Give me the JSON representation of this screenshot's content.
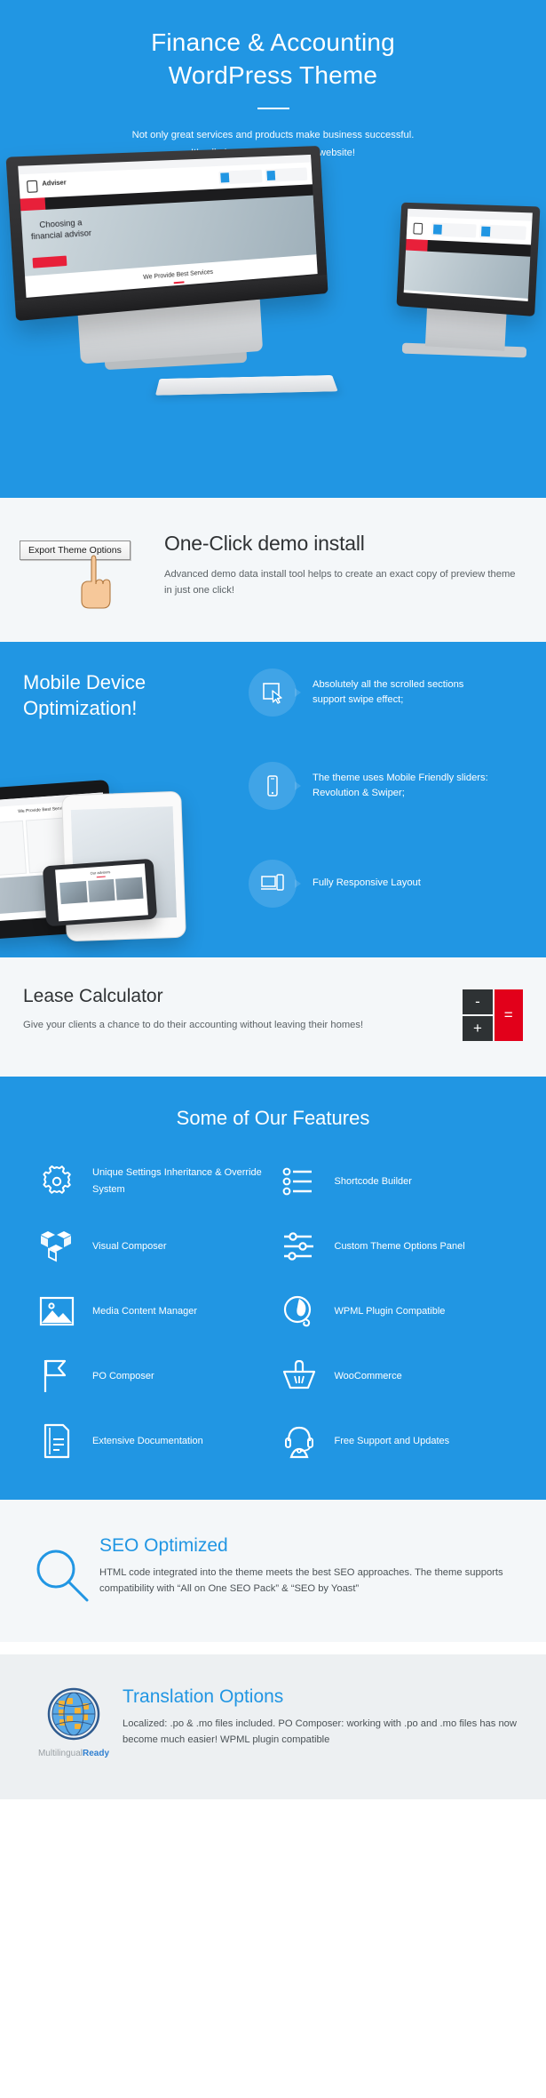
{
  "hero": {
    "title_line1": "Finance & Accounting",
    "title_line2": "WordPress Theme",
    "subtitle_line1": "Not only great services and products make business successful.",
    "subtitle_line2": "It’s all about your company’s website!",
    "mockup": {
      "logo_text": "Adviser",
      "hero_heading": "Choosing a\nfinancial advisor",
      "section_title": "We Provide Best Services"
    }
  },
  "oneclick": {
    "button_label": "Export Theme Options",
    "title": "One-Click demo install",
    "description": "Advanced demo data install tool helps to create an exact copy of preview theme in just one click!"
  },
  "mobile": {
    "title_line1": "Mobile Device",
    "title_line2": "Optimization!",
    "features": [
      {
        "icon": "cursor-click-icon",
        "text": "Absolutely all the scrolled sections support swipe effect;"
      },
      {
        "icon": "smartphone-icon",
        "text": "The theme uses Mobile Friendly sliders:\nRevolution & Swiper;"
      },
      {
        "icon": "responsive-devices-icon",
        "text": "Fully Responsive Layout"
      }
    ]
  },
  "lease": {
    "title": "Lease Calculator",
    "description": "Give your clients a chance to do their accounting without leaving their homes!",
    "calculator": {
      "minus": "-",
      "plus": "+",
      "equals": "=",
      "key_color": "#2e3234",
      "accent_color": "#e2001a"
    }
  },
  "features": {
    "title": "Some of Our Features",
    "items": [
      {
        "icon": "gear-icon",
        "label": "Unique Settings Inheritance & Override System"
      },
      {
        "icon": "list-bullets-icon",
        "label": "Shortcode Builder"
      },
      {
        "icon": "cubes-icon",
        "label": "Visual Composer"
      },
      {
        "icon": "sliders-icon",
        "label": "Custom Theme Options Panel"
      },
      {
        "icon": "image-icon",
        "label": "Media Content Manager"
      },
      {
        "icon": "wpml-icon",
        "label": "WPML Plugin Compatible"
      },
      {
        "icon": "flag-icon",
        "label": "PO Composer"
      },
      {
        "icon": "basket-icon",
        "label": "WooCommerce"
      },
      {
        "icon": "document-icon",
        "label": "Extensive Documentation"
      },
      {
        "icon": "headset-support-icon",
        "label": "Free Support and Updates"
      }
    ]
  },
  "seo": {
    "icon": "magnifier-icon",
    "title": "SEO Optimized",
    "description": "HTML code integrated into the theme meets the best SEO approaches. The theme supports compatibility with “All on One SEO Pack” & “SEO by Yoast”"
  },
  "translation": {
    "icon": "globe-icon",
    "badge_part1": "Multilingual",
    "badge_part2": "Ready",
    "title": "Translation Options",
    "description": "Localized: .po & .mo files included. PO Composer: working with .po and .mo files has now become much easier! WPML plugin compatible"
  },
  "colors": {
    "brand_blue": "#2196e3",
    "light_bg": "#f4f7f9",
    "grey_bg": "#edf0f2",
    "red": "#e2001a",
    "dark": "#2e3234"
  }
}
